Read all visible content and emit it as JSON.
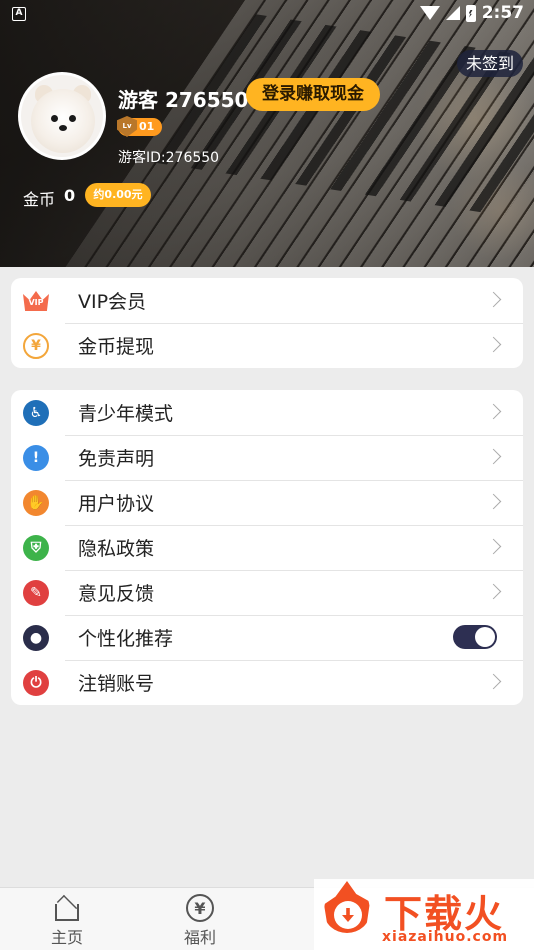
{
  "status_bar": {
    "notification_icon": "A",
    "time": "2:57"
  },
  "profile": {
    "checkin_label": "未签到",
    "username": "游客 276550",
    "login_button": "登录赚取现金",
    "level": "01",
    "guest_id": "游客ID:276550",
    "coins_label": "金币",
    "coins_value": "0",
    "coins_approx": "约0.00元"
  },
  "card1": {
    "items": [
      {
        "label": "VIP会员",
        "icon": "vip-crown-icon",
        "color": "#f46b4c"
      },
      {
        "label": "金币提现",
        "icon": "coin-yen-icon",
        "color": "#f3a63b"
      }
    ]
  },
  "card2": {
    "items": [
      {
        "label": "青少年模式",
        "icon": "child-icon",
        "color": "#1f6fb8"
      },
      {
        "label": "免责声明",
        "icon": "exclamation-icon",
        "color": "#3a8ee6"
      },
      {
        "label": "用户协议",
        "icon": "handshake-icon",
        "color": "#f2872f"
      },
      {
        "label": "隐私政策",
        "icon": "shield-lock-icon",
        "color": "#3db34a"
      },
      {
        "label": "意见反馈",
        "icon": "edit-note-icon",
        "color": "#e04040"
      },
      {
        "label": "个性化推荐",
        "icon": "person-icon",
        "color": "#2a2d4a",
        "toggle_on": true
      },
      {
        "label": "注销账号",
        "icon": "power-icon",
        "color": "#e04040"
      }
    ]
  },
  "bottom_nav": {
    "items": [
      {
        "label": "主页",
        "icon": "home-icon"
      },
      {
        "label": "福利",
        "icon": "yen-circle-icon"
      }
    ]
  },
  "watermark": {
    "brand": "下载火",
    "url": "xiazaihuo.com",
    "color": "#f25022"
  }
}
